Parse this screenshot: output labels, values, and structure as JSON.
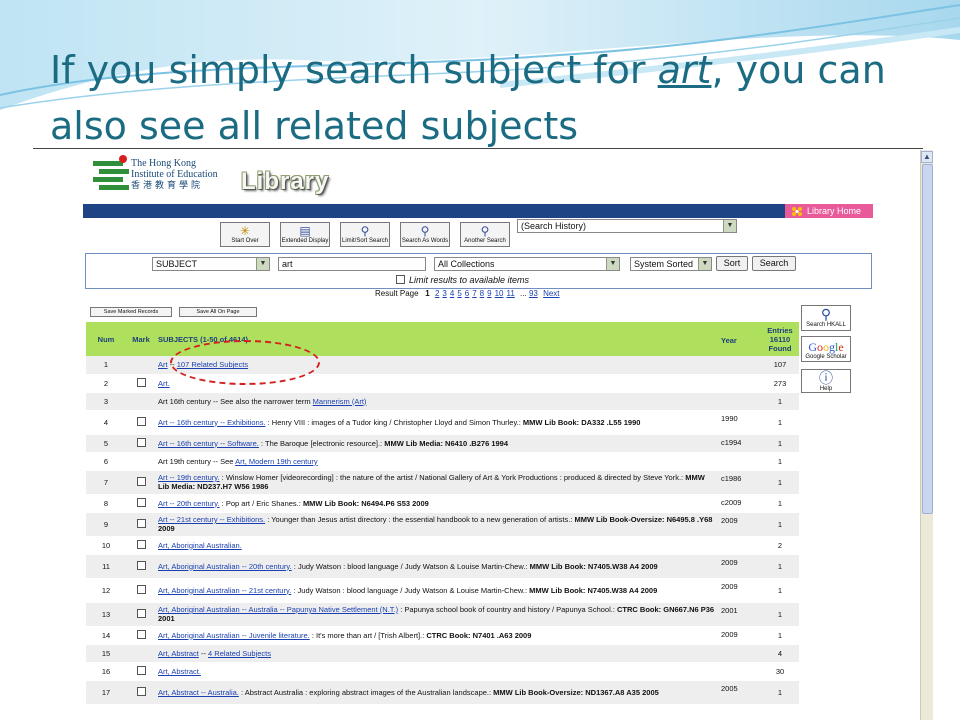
{
  "slide": {
    "title_before": "If you simply search subject for ",
    "title_highlight": "art",
    "title_after": ", you can also see all related subjects"
  },
  "header": {
    "logo_en_line1": "The Hong Kong",
    "logo_en_line2": "Institute of Education",
    "logo_cn": "香港教育學院",
    "library_word": "Library",
    "home_link": "Library Home"
  },
  "toolbar": {
    "start_over": "Start Over",
    "extended_display": "Extended Display",
    "limit_sort": "Limit/Sort Search",
    "search_as_words": "Search As Words",
    "another_search": "Another Search",
    "history_select": "(Search History)"
  },
  "search": {
    "field_select": "SUBJECT",
    "query": "art",
    "collection_select": "All Collections",
    "sort_select": "System Sorted",
    "sort_button": "Sort",
    "search_button": "Search",
    "limit_label": "Limit results to available items"
  },
  "pagination": {
    "label": "Result Page",
    "current": "1",
    "pages": [
      "2",
      "3",
      "4",
      "5",
      "6",
      "7",
      "8",
      "9",
      "10",
      "11"
    ],
    "ellipsis": "...",
    "last": "93",
    "next": "Next"
  },
  "actions": {
    "save_marked": "Save Marked Records",
    "save_all": "Save All On Page"
  },
  "side": {
    "hkall": "Search HKALL",
    "google": "Google",
    "google_sub": "Google Scholar",
    "help": "Help"
  },
  "table": {
    "headers": {
      "num": "Num",
      "mark": "Mark",
      "subjects": "SUBJECTS (1-50 of 4614)",
      "year": "Year",
      "entries_l1": "Entries",
      "entries_l2": "16110",
      "entries_l3": "Found"
    },
    "rows": [
      {
        "num": "1",
        "checkbox": false,
        "link": "Art",
        "sep": " -- ",
        "link2": "107 Related Subjects",
        "rest": "",
        "call": "",
        "year": "",
        "entries": "107"
      },
      {
        "num": "2",
        "checkbox": true,
        "link": "Art.",
        "sep": "",
        "link2": "",
        "rest": "",
        "call": "",
        "year": "",
        "entries": "273"
      },
      {
        "num": "3",
        "checkbox": false,
        "link": "",
        "sep": "Art 16th century -- See also the narrower term ",
        "link2": "Mannerism (Art)",
        "rest": "",
        "call": "",
        "year": "",
        "entries": "1"
      },
      {
        "num": "4",
        "checkbox": true,
        "link": "Art -- 16th century -- Exhibitions.",
        "sep": "",
        "link2": "",
        "rest": " : Henry VIII : images of a Tudor king / Christopher Lloyd and Simon Thurley.: ",
        "call": "MMW Lib Book: DA332 .L55 1990",
        "year": "1990",
        "entries": "1"
      },
      {
        "num": "5",
        "checkbox": true,
        "link": "Art -- 16th century -- Software.",
        "sep": "",
        "link2": "",
        "rest": " : The Baroque [electronic resource].: ",
        "call": "MMW Lib Media: N6410 .B276 1994",
        "year": "c1994",
        "entries": "1"
      },
      {
        "num": "6",
        "checkbox": false,
        "link": "",
        "sep": "Art 19th century -- See ",
        "link2": "Art, Modern 19th century",
        "rest": "",
        "call": "",
        "year": "",
        "entries": "1"
      },
      {
        "num": "7",
        "checkbox": true,
        "link": "Art -- 19th century.",
        "sep": "",
        "link2": "",
        "rest": " : Winslow Homer [videorecording] : the nature of the artist / National Gallery of Art & York Productions : produced & directed by Steve York.: ",
        "call": "MMW Lib Media: ND237.H7 W56 1986",
        "year": "c1986",
        "entries": "1"
      },
      {
        "num": "8",
        "checkbox": true,
        "link": "Art -- 20th century.",
        "sep": "",
        "link2": "",
        "rest": " : Pop art / Eric Shanes.: ",
        "call": "MMW Lib Book: N6494.P6 S53 2009",
        "year": "c2009",
        "entries": "1"
      },
      {
        "num": "9",
        "checkbox": true,
        "link": "Art -- 21st century -- Exhibitions.",
        "sep": "",
        "link2": "",
        "rest": " : Younger than Jesus artist directory : the essential handbook to a new generation of artists.: ",
        "call": "MMW Lib Book-Oversize: N6495.8 .Y68 2009",
        "year": "2009",
        "entries": "1"
      },
      {
        "num": "10",
        "checkbox": true,
        "link": "Art, Aboriginal Australian.",
        "sep": "",
        "link2": "",
        "rest": "",
        "call": "",
        "year": "",
        "entries": "2"
      },
      {
        "num": "11",
        "checkbox": true,
        "link": "Art, Aboriginal Australian -- 20th century.",
        "sep": "",
        "link2": "",
        "rest": " : Judy Watson : blood language / Judy Watson & Louise Martin-Chew.: ",
        "call": "MMW Lib Book: N7405.W38 A4 2009",
        "year": "2009",
        "entries": "1"
      },
      {
        "num": "12",
        "checkbox": true,
        "link": "Art, Aboriginal Australian -- 21st century.",
        "sep": "",
        "link2": "",
        "rest": " : Judy Watson : blood language / Judy Watson & Louise Martin-Chew.: ",
        "call": "MMW Lib Book: N7405.W38 A4 2009",
        "year": "2009",
        "entries": "1"
      },
      {
        "num": "13",
        "checkbox": true,
        "link": "Art, Aboriginal Australian -- Australia -- Papunya Native Settlement (N.T.)",
        "sep": "",
        "link2": "",
        "rest": " : Papunya school book of country and history / Papunya School.: ",
        "call": "CTRC Book: GN667.N6 P36 2001",
        "year": "2001",
        "entries": "1"
      },
      {
        "num": "14",
        "checkbox": true,
        "link": "Art, Aboriginal Australian -- Juvenile literature.",
        "sep": "",
        "link2": "",
        "rest": " : It's more than art / [Trish Albert].: ",
        "call": "CTRC Book: N7401 .A63 2009",
        "year": "2009",
        "entries": "1"
      },
      {
        "num": "15",
        "checkbox": false,
        "link": "Art, Abstract",
        "sep": " -- ",
        "link2": "4 Related Subjects",
        "rest": "",
        "call": "",
        "year": "",
        "entries": "4"
      },
      {
        "num": "16",
        "checkbox": true,
        "link": "Art, Abstract.",
        "sep": "",
        "link2": "",
        "rest": "",
        "call": "",
        "year": "",
        "entries": "30"
      },
      {
        "num": "17",
        "checkbox": true,
        "link": "Art, Abstract -- Australia.",
        "sep": "",
        "link2": "",
        "rest": " : Abstract Australia : exploring abstract images of the Australian landscape.: ",
        "call": "MMW Lib Book-Oversize: ND1367.A8 A35 2005",
        "year": "2005",
        "entries": "1"
      }
    ]
  },
  "colors": {
    "title": "#1b6b82",
    "nav": "#1f4486",
    "header_row": "#aee05e",
    "home_link": "#e85a9a",
    "annotation": "#d42020",
    "link": "#1a3fb0"
  }
}
